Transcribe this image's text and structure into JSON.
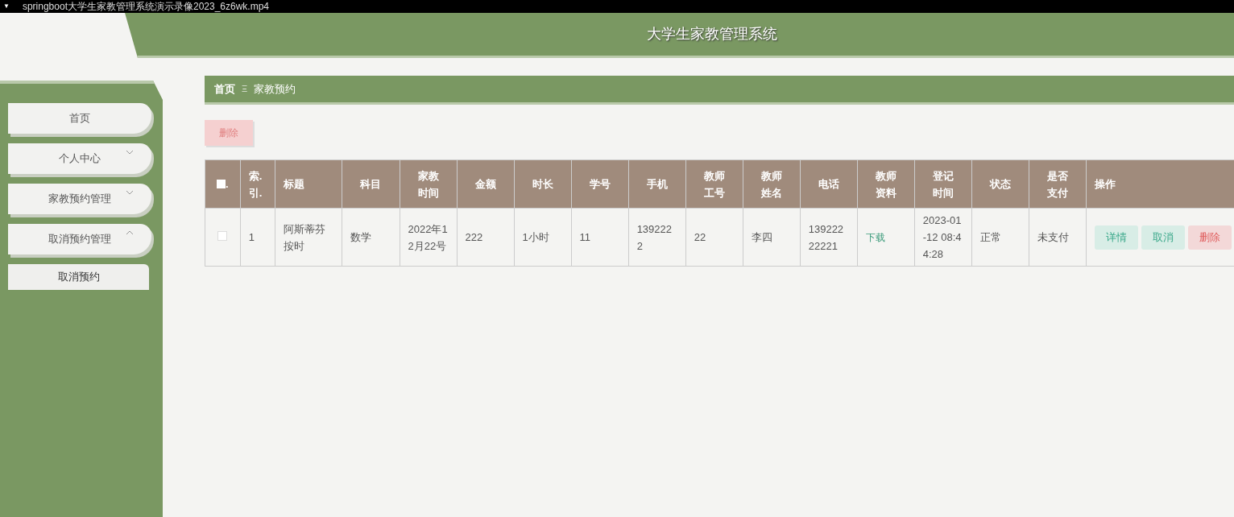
{
  "player_menu_glyph": "▼",
  "player_title": "springboot大学生家教管理系统演示录像2023_6z6wk.mp4",
  "app_title": "大学生家教管理系统",
  "sidebar": {
    "items": [
      {
        "label": "首页",
        "kind": "link"
      },
      {
        "label": "个人中心",
        "kind": "group",
        "expanded": false
      },
      {
        "label": "家教预约管理",
        "kind": "group",
        "expanded": false
      },
      {
        "label": "取消预约管理",
        "kind": "group",
        "expanded": true,
        "children": [
          {
            "label": "取消预约"
          }
        ]
      }
    ]
  },
  "breadcrumb": [
    {
      "label": "首页"
    },
    {
      "separator": "Ξ"
    },
    {
      "label": "家教预约"
    }
  ],
  "toolbar": {
    "delete_button": "删除"
  },
  "table": {
    "select_all": {
      "checked": false,
      "suffix": "."
    },
    "columns": [
      "索.引.",
      "标题",
      "科目",
      "家教时间",
      "金额",
      "时长",
      "学号",
      "手机",
      "教师工号",
      "教师姓名",
      "电话",
      "教师资料",
      "登记时间",
      "状态",
      "是否支付",
      "操作"
    ],
    "rows": [
      {
        "checked": false,
        "cells": [
          {
            "kind": "text",
            "value": "1"
          },
          {
            "kind": "text",
            "value": "阿斯蒂芬按时"
          },
          {
            "kind": "text",
            "value": "数学"
          },
          {
            "kind": "text",
            "value": "2022年12月22号"
          },
          {
            "kind": "text",
            "value": "222"
          },
          {
            "kind": "text",
            "value": "1小时"
          },
          {
            "kind": "text",
            "value": "11"
          },
          {
            "kind": "text",
            "value": "1392222"
          },
          {
            "kind": "text",
            "value": "22"
          },
          {
            "kind": "text",
            "value": "李四"
          },
          {
            "kind": "text",
            "value": "13922222221"
          },
          {
            "kind": "link",
            "value": "下载"
          },
          {
            "kind": "text",
            "value": "2023-01-12 08:44:28"
          },
          {
            "kind": "text",
            "value": "正常"
          },
          {
            "kind": "text",
            "value": "未支付"
          },
          {
            "kind": "actions",
            "buttons": [
              {
                "kind": "detail",
                "label": "详情"
              },
              {
                "kind": "cancel",
                "label": "取消"
              },
              {
                "kind": "delete",
                "label": "删除"
              }
            ]
          }
        ]
      }
    ]
  }
}
